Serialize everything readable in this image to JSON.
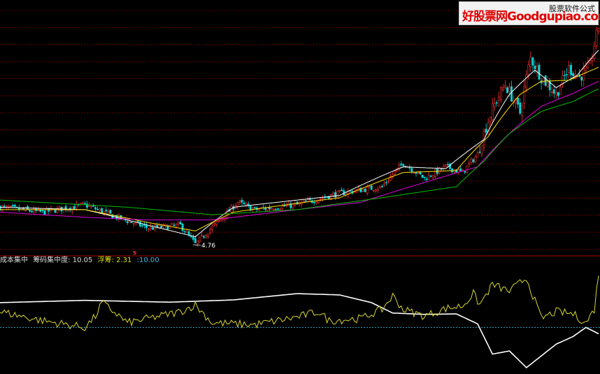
{
  "watermark": {
    "brand": "好股票网Goodgupiao.com",
    "sub": "股票软件公式"
  },
  "main_panel": {
    "low_label": "4.76",
    "marker": "s"
  },
  "indicator_header": {
    "name": "成本集中",
    "chip_label": "筹码集中度:",
    "chip_value": "10.05",
    "float_label": "浮筹:",
    "float_value": "2.31",
    "third_value": ":10.00"
  },
  "colors": {
    "background": "#000000",
    "grid": "#7a0000",
    "up_candle": "#ff3030",
    "down_candle": "#00d8d8",
    "ma_white": "#ffffff",
    "ma_yellow": "#ffe000",
    "ma_magenta": "#e000e0",
    "ma_green": "#00c000",
    "chip_line": "#ffffff",
    "float_line": "#d8d830",
    "ref_line": "#3aa8c8",
    "float_label": "#e0e000",
    "third_label": "#40b8e0"
  },
  "chart_data": {
    "type": "line",
    "price": {
      "anchors": [
        [
          0,
          6.1
        ],
        [
          20,
          5.9
        ],
        [
          40,
          6.2
        ],
        [
          55,
          5.7
        ],
        [
          70,
          5.3
        ],
        [
          85,
          5.4
        ],
        [
          92,
          4.76
        ],
        [
          105,
          5.7
        ],
        [
          112,
          6.3
        ],
        [
          120,
          6.0
        ],
        [
          140,
          6.2
        ],
        [
          160,
          6.7
        ],
        [
          180,
          7.0
        ],
        [
          190,
          8.2
        ],
        [
          200,
          7.4
        ],
        [
          210,
          8.0
        ],
        [
          218,
          7.7
        ],
        [
          225,
          8.7
        ],
        [
          232,
          11.8
        ],
        [
          238,
          13.9
        ],
        [
          245,
          11.5
        ],
        [
          250,
          16.6
        ],
        [
          255,
          14.6
        ],
        [
          262,
          13.0
        ],
        [
          268,
          15.5
        ],
        [
          273,
          14.6
        ],
        [
          278,
          15.7
        ],
        [
          282,
          20.5
        ]
      ],
      "low_annotation": 4.76
    },
    "moving_averages": [
      {
        "key": "ma5",
        "anchors": [
          [
            0,
            6.1
          ],
          [
            40,
            6.0
          ],
          [
            70,
            5.4
          ],
          [
            92,
            5.0
          ],
          [
            110,
            6.1
          ],
          [
            160,
            6.6
          ],
          [
            190,
            8.0
          ],
          [
            210,
            7.9
          ],
          [
            228,
            9.6
          ],
          [
            240,
            13.0
          ],
          [
            252,
            15.3
          ],
          [
            262,
            13.6
          ],
          [
            272,
            14.8
          ],
          [
            282,
            17.5
          ]
        ]
      },
      {
        "key": "ma10",
        "anchors": [
          [
            0,
            6.0
          ],
          [
            40,
            6.0
          ],
          [
            70,
            5.5
          ],
          [
            92,
            5.2
          ],
          [
            110,
            5.9
          ],
          [
            160,
            6.5
          ],
          [
            190,
            7.7
          ],
          [
            215,
            7.8
          ],
          [
            230,
            9.8
          ],
          [
            245,
            13.0
          ],
          [
            255,
            14.2
          ],
          [
            268,
            14.3
          ],
          [
            282,
            15.6
          ]
        ]
      },
      {
        "key": "ma30",
        "anchors": [
          [
            0,
            5.9
          ],
          [
            40,
            5.7
          ],
          [
            70,
            5.6
          ],
          [
            100,
            5.6
          ],
          [
            130,
            5.9
          ],
          [
            170,
            6.3
          ],
          [
            200,
            7.2
          ],
          [
            225,
            8.0
          ],
          [
            240,
            10.0
          ],
          [
            255,
            12.0
          ],
          [
            270,
            13.1
          ],
          [
            282,
            14.2
          ]
        ]
      },
      {
        "key": "ma60",
        "anchors": [
          [
            0,
            6.4
          ],
          [
            60,
            6.1
          ],
          [
            100,
            5.8
          ],
          [
            140,
            6.0
          ],
          [
            180,
            6.5
          ],
          [
            215,
            7.0
          ],
          [
            228,
            8.3
          ],
          [
            240,
            10.0
          ],
          [
            255,
            11.6
          ],
          [
            270,
            12.4
          ],
          [
            282,
            13.5
          ]
        ]
      }
    ],
    "indicator": {
      "series": [
        {
          "name": "筹码集中度",
          "anchors": [
            [
              0,
              15.5
            ],
            [
              40,
              16.0
            ],
            [
              80,
              15.6
            ],
            [
              110,
              16.1
            ],
            [
              140,
              17.5
            ],
            [
              160,
              17.2
            ],
            [
              175,
              15.5
            ],
            [
              185,
              13.2
            ],
            [
              200,
              12.9
            ],
            [
              215,
              13.0
            ],
            [
              225,
              10.8
            ],
            [
              232,
              4.1
            ],
            [
              240,
              4.8
            ],
            [
              248,
              1.1
            ],
            [
              262,
              6.3
            ],
            [
              270,
              8.0
            ],
            [
              276,
              10.0
            ],
            [
              282,
              8.6
            ]
          ]
        },
        {
          "name": "浮筹",
          "anchors": [
            [
              0,
              13.5
            ],
            [
              20,
              11.5
            ],
            [
              40,
              10.0
            ],
            [
              45,
              12.5
            ],
            [
              48,
              15.5
            ],
            [
              55,
              13.0
            ],
            [
              60,
              11.0
            ],
            [
              70,
              12.0
            ],
            [
              85,
              13.5
            ],
            [
              92,
              15.0
            ],
            [
              100,
              11.0
            ],
            [
              120,
              10.6
            ],
            [
              140,
              12.3
            ],
            [
              150,
              13.5
            ],
            [
              155,
              11.5
            ],
            [
              170,
              12.0
            ],
            [
              180,
              14.0
            ],
            [
              185,
              17.0
            ],
            [
              190,
              14.0
            ],
            [
              200,
              12.5
            ],
            [
              210,
              14.2
            ],
            [
              218,
              14.8
            ],
            [
              223,
              17.5
            ],
            [
              226,
              15.0
            ],
            [
              232,
              19.5
            ],
            [
              240,
              18.0
            ],
            [
              248,
              21.0
            ],
            [
              255,
              12.0
            ],
            [
              262,
              13.5
            ],
            [
              270,
              13.0
            ],
            [
              276,
              11.0
            ],
            [
              280,
              14.0
            ],
            [
              282,
              22.0
            ]
          ]
        }
      ],
      "reference_line": 10.0
    }
  }
}
